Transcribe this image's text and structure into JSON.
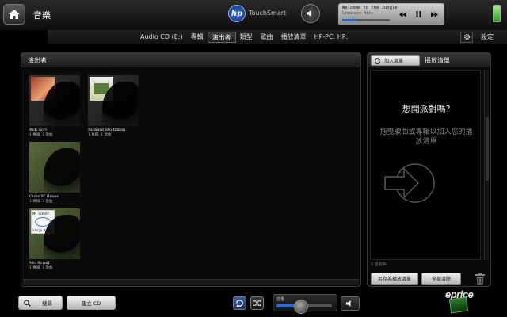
{
  "topbar": {
    "title": "音樂",
    "logo": "hp",
    "brand": "TouchSmart",
    "now_playing": {
      "track": "Welcome to the Jungle",
      "album": "Greatest Hits",
      "progress": 0.3
    },
    "icons": {
      "home": "home-icon",
      "volume": "speaker-icon",
      "prev": "previous-track-icon",
      "pause": "pause-icon",
      "next": "next-track-icon",
      "battery": "battery-icon"
    }
  },
  "nav": {
    "items": [
      {
        "label": "Audio CD (E:)",
        "active": false
      },
      {
        "label": "專輯",
        "active": false
      },
      {
        "label": "演出者",
        "active": true
      },
      {
        "label": "類型",
        "active": false
      },
      {
        "label": "歌曲",
        "active": false
      },
      {
        "label": "播放清單",
        "active": false
      },
      {
        "label": "HP-PC: HP:",
        "active": false
      }
    ],
    "settings_label": "設定"
  },
  "artists_panel": {
    "title": "演出者",
    "tiles": [
      {
        "name": "Bob Acri",
        "meta": "1 專輯, 1 歌曲"
      },
      {
        "name": "Richard Stoltzman",
        "meta": "1 專輯, 1 歌曲"
      },
      {
        "name": "Guns N' Roses",
        "meta": "1 專輯, 3 歌曲"
      },
      {
        "name": "Mr. Scruff",
        "meta": "1 專輯, 1 歌曲"
      }
    ],
    "cover_text": {
      "scruff": "MR SCRUFF",
      "scruff_sub": "ninja tuna"
    }
  },
  "playlist_panel": {
    "add_label": "加入清單",
    "title": "播放清單",
    "prompt": "想開派對嗎?",
    "hint": "拖曳歌曲或專輯以加入您的播放清單",
    "count": "0 首歌曲",
    "save_label": "另存為播放清單",
    "clear_label": "全部清除"
  },
  "bottom": {
    "search_label": "搜尋",
    "create_cd_label": "建立 CD",
    "volume_label": "音量",
    "volume_level": 0.35
  },
  "watermark": {
    "text": "eprice"
  },
  "colors": {
    "accent": "#2e6bd0",
    "background": "#000000",
    "panel": "#0a0a0a"
  }
}
